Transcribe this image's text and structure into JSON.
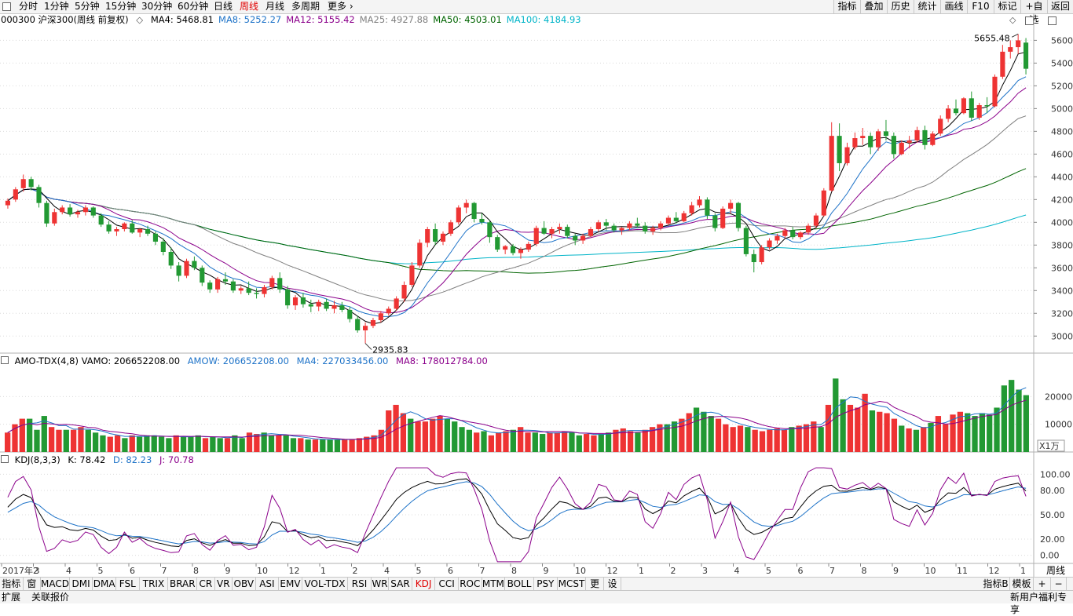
{
  "topbar": {
    "tabs": [
      "分时",
      "1分钟",
      "5分钟",
      "15分钟",
      "30分钟",
      "60分钟",
      "日线",
      "周线",
      "月线",
      "多周期",
      "更多"
    ],
    "active_tab": "周线",
    "right_tabs": [
      "指标",
      "叠加",
      "历史",
      "统计",
      "画线",
      "F10",
      "标记",
      "+自选",
      "返回"
    ]
  },
  "main_panel": {
    "stock_label": "000300 沪深300(周线 前复权)",
    "ma": [
      {
        "label": "MA4: 5468.81",
        "color": "#000000"
      },
      {
        "label": "MA8: 5252.27",
        "color": "#1e73c8"
      },
      {
        "label": "MA12: 5155.42",
        "color": "#8b008b"
      },
      {
        "label": "MA25: 4927.88",
        "color": "#808080"
      },
      {
        "label": "MA50: 4503.01",
        "color": "#006400"
      },
      {
        "label": "MA100: 4184.93",
        "color": "#00b4c8"
      }
    ],
    "y_ticks": [
      "5600",
      "5400",
      "5200",
      "5000",
      "4800",
      "4600",
      "4400",
      "4200",
      "4000",
      "3800",
      "3600",
      "3400",
      "3200",
      "3000"
    ],
    "high_label": "5655.48",
    "low_label": "2935.83"
  },
  "volume_panel": {
    "label": "AMO-TDX(4,8) VAMO: 206652208.00",
    "amow": "AMOW: 206652208.00",
    "ma4": "MA4: 227033456.00",
    "ma8": "MA8: 178012784.00",
    "y_ticks": [
      "20000",
      "10000"
    ],
    "unit": "X1万"
  },
  "kdj_panel": {
    "label": "KDJ(8,3,3)",
    "k": "K: 78.42",
    "d": "D: 82.23",
    "j": "J: 70.78",
    "y_ticks": [
      "100.00",
      "80.00",
      "50.00",
      "20.00",
      "0.00"
    ]
  },
  "x_axis": [
    "2017年2",
    "3",
    "4",
    "5",
    "6",
    "7",
    "8",
    "9",
    "10",
    "12",
    "1",
    "2",
    "4",
    "5",
    "6",
    "7",
    "8",
    "9",
    "10",
    "12",
    "1",
    "2",
    "3",
    "4",
    "5",
    "6",
    "7",
    "8",
    "9",
    "10",
    "11",
    "12",
    "1"
  ],
  "period_label": "周线",
  "indicator_tabs": [
    "指标A",
    "窗口",
    "MACD",
    "DMI",
    "DMA",
    "FSL",
    "TRIX",
    "BRAR",
    "CR",
    "VR",
    "OBV",
    "ASI",
    "EMV",
    "VOL-TDX",
    "RSI",
    "WR",
    "SAR",
    "KDJ",
    "CCI",
    "ROC",
    "MTM",
    "BOLL",
    "PSY",
    "MCST",
    "更多",
    "设置"
  ],
  "active_indicator": "KDJ",
  "right_buttons": [
    "指标B",
    "模板",
    "+",
    "−"
  ],
  "status": {
    "left1": "扩展",
    "left2": "关联报价",
    "right": "新用户福利专享"
  },
  "colors": {
    "up": "#ee3333",
    "down": "#229933",
    "accent": "#e00000"
  },
  "chart_data": [
    {
      "type": "candlestick",
      "title": "000300 沪深300(周线 前复权)",
      "ylim": [
        2850,
        5720
      ],
      "high": 5655.48,
      "low": 2935.83,
      "ohlc": [
        [
          4150,
          4210,
          4120,
          4190
        ],
        [
          4200,
          4310,
          4180,
          4290
        ],
        [
          4300,
          4420,
          4270,
          4380
        ],
        [
          4380,
          4400,
          4280,
          4310
        ],
        [
          4310,
          4330,
          4130,
          4170
        ],
        [
          4170,
          4190,
          3960,
          3990
        ],
        [
          3990,
          4120,
          3970,
          4090
        ],
        [
          4090,
          4150,
          4070,
          4130
        ],
        [
          4130,
          4160,
          4050,
          4070
        ],
        [
          4070,
          4110,
          4040,
          4090
        ],
        [
          4090,
          4150,
          4060,
          4130
        ],
        [
          4130,
          4140,
          4040,
          4060
        ],
        [
          4060,
          4080,
          3960,
          3980
        ],
        [
          3980,
          4010,
          3900,
          3920
        ],
        [
          3920,
          3960,
          3880,
          3940
        ],
        [
          3940,
          4000,
          3920,
          3990
        ],
        [
          3990,
          4020,
          3900,
          3910
        ],
        [
          3910,
          3950,
          3870,
          3940
        ],
        [
          3940,
          3970,
          3880,
          3900
        ],
        [
          3900,
          3920,
          3800,
          3830
        ],
        [
          3830,
          3860,
          3710,
          3740
        ],
        [
          3740,
          3780,
          3590,
          3620
        ],
        [
          3620,
          3650,
          3480,
          3530
        ],
        [
          3530,
          3680,
          3510,
          3660
        ],
        [
          3660,
          3700,
          3580,
          3600
        ],
        [
          3600,
          3620,
          3440,
          3470
        ],
        [
          3470,
          3490,
          3380,
          3410
        ],
        [
          3410,
          3520,
          3380,
          3500
        ],
        [
          3500,
          3560,
          3450,
          3480
        ],
        [
          3480,
          3500,
          3380,
          3400
        ],
        [
          3400,
          3440,
          3370,
          3420
        ],
        [
          3420,
          3480,
          3360,
          3380
        ],
        [
          3380,
          3420,
          3330,
          3370
        ],
        [
          3370,
          3450,
          3340,
          3430
        ],
        [
          3430,
          3530,
          3410,
          3510
        ],
        [
          3510,
          3560,
          3380,
          3410
        ],
        [
          3410,
          3440,
          3240,
          3270
        ],
        [
          3270,
          3360,
          3230,
          3340
        ],
        [
          3340,
          3380,
          3250,
          3280
        ],
        [
          3280,
          3320,
          3210,
          3260
        ],
        [
          3260,
          3320,
          3220,
          3300
        ],
        [
          3300,
          3330,
          3220,
          3240
        ],
        [
          3240,
          3310,
          3200,
          3270
        ],
        [
          3270,
          3300,
          3210,
          3230
        ],
        [
          3230,
          3260,
          3120,
          3150
        ],
        [
          3150,
          3180,
          3030,
          3050
        ],
        [
          3050,
          3120,
          2936,
          3090
        ],
        [
          3090,
          3160,
          3070,
          3140
        ],
        [
          3140,
          3220,
          3120,
          3200
        ],
        [
          3200,
          3260,
          3180,
          3240
        ],
        [
          3240,
          3350,
          3220,
          3330
        ],
        [
          3330,
          3480,
          3300,
          3450
        ],
        [
          3450,
          3650,
          3430,
          3620
        ],
        [
          3620,
          3850,
          3600,
          3820
        ],
        [
          3820,
          3960,
          3780,
          3940
        ],
        [
          3940,
          3990,
          3800,
          3830
        ],
        [
          3830,
          3920,
          3800,
          3900
        ],
        [
          3900,
          4020,
          3880,
          4000
        ],
        [
          4000,
          4150,
          3980,
          4130
        ],
        [
          4130,
          4200,
          4080,
          4170
        ],
        [
          4170,
          4180,
          4000,
          4030
        ],
        [
          4030,
          4080,
          3980,
          4000
        ],
        [
          4000,
          4020,
          3820,
          3870
        ],
        [
          3870,
          3890,
          3740,
          3760
        ],
        [
          3760,
          3800,
          3720,
          3790
        ],
        [
          3790,
          3810,
          3710,
          3730
        ],
        [
          3730,
          3780,
          3680,
          3760
        ],
        [
          3760,
          3830,
          3740,
          3810
        ],
        [
          3810,
          3970,
          3790,
          3950
        ],
        [
          3950,
          4010,
          3890,
          3900
        ],
        [
          3900,
          3960,
          3860,
          3940
        ],
        [
          3940,
          3990,
          3900,
          3960
        ],
        [
          3960,
          3980,
          3860,
          3880
        ],
        [
          3880,
          3900,
          3800,
          3840
        ],
        [
          3840,
          3900,
          3810,
          3880
        ],
        [
          3880,
          3960,
          3870,
          3940
        ],
        [
          3940,
          4020,
          3920,
          4000
        ],
        [
          4000,
          4030,
          3930,
          3970
        ],
        [
          3970,
          3990,
          3910,
          3930
        ],
        [
          3930,
          3960,
          3890,
          3950
        ],
        [
          3950,
          4010,
          3930,
          3990
        ],
        [
          3990,
          4040,
          3950,
          3970
        ],
        [
          3970,
          4000,
          3900,
          3920
        ],
        [
          3920,
          3970,
          3890,
          3950
        ],
        [
          3950,
          4010,
          3930,
          3990
        ],
        [
          3990,
          4060,
          3970,
          4040
        ],
        [
          4040,
          4090,
          3990,
          4010
        ],
        [
          4010,
          4100,
          4000,
          4080
        ],
        [
          4080,
          4180,
          4060,
          4150
        ],
        [
          4150,
          4230,
          4130,
          4200
        ],
        [
          4200,
          4220,
          4030,
          4060
        ],
        [
          4060,
          4080,
          3920,
          3950
        ],
        [
          3950,
          4140,
          3940,
          4120
        ],
        [
          4120,
          4200,
          4080,
          4170
        ],
        [
          4170,
          4180,
          3920,
          3950
        ],
        [
          3950,
          3970,
          3700,
          3720
        ],
        [
          3720,
          3760,
          3560,
          3650
        ],
        [
          3650,
          3800,
          3630,
          3780
        ],
        [
          3780,
          3860,
          3760,
          3840
        ],
        [
          3840,
          3900,
          3810,
          3880
        ],
        [
          3880,
          3950,
          3860,
          3930
        ],
        [
          3930,
          3960,
          3850,
          3870
        ],
        [
          3870,
          3920,
          3850,
          3910
        ],
        [
          3910,
          3990,
          3890,
          3970
        ],
        [
          3970,
          4080,
          3950,
          4060
        ],
        [
          4060,
          4300,
          4050,
          4280
        ],
        [
          4280,
          4880,
          4270,
          4760
        ],
        [
          4760,
          4870,
          4450,
          4520
        ],
        [
          4520,
          4700,
          4500,
          4660
        ],
        [
          4660,
          4790,
          4640,
          4740
        ],
        [
          4740,
          4830,
          4680,
          4760
        ],
        [
          4760,
          4790,
          4600,
          4660
        ],
        [
          4660,
          4820,
          4630,
          4800
        ],
        [
          4800,
          4900,
          4720,
          4760
        ],
        [
          4760,
          4790,
          4560,
          4600
        ],
        [
          4600,
          4720,
          4590,
          4700
        ],
        [
          4700,
          4760,
          4650,
          4720
        ],
        [
          4720,
          4840,
          4700,
          4810
        ],
        [
          4810,
          4850,
          4640,
          4680
        ],
        [
          4680,
          4800,
          4670,
          4780
        ],
        [
          4780,
          4940,
          4760,
          4910
        ],
        [
          4910,
          5030,
          4880,
          5000
        ],
        [
          5000,
          5080,
          4940,
          4960
        ],
        [
          4960,
          5100,
          4950,
          5090
        ],
        [
          5090,
          5150,
          4890,
          4920
        ],
        [
          4920,
          5050,
          4900,
          5030
        ],
        [
          5030,
          5100,
          4960,
          5020
        ],
        [
          5020,
          5300,
          5010,
          5280
        ],
        [
          5280,
          5560,
          5260,
          5500
        ],
        [
          5500,
          5600,
          5440,
          5540
        ],
        [
          5540,
          5655,
          5480,
          5600
        ],
        [
          5580,
          5620,
          5300,
          5350
        ]
      ]
    },
    {
      "type": "bar",
      "title": "AMO-TDX(4,8)",
      "unit": "X1万",
      "ylim": [
        0,
        30000
      ],
      "values": [
        7000,
        10000,
        12000,
        12000,
        8000,
        13000,
        9000,
        8000,
        8000,
        8000,
        9000,
        8000,
        7000,
        6000,
        5500,
        6000,
        5000,
        6000,
        5500,
        6000,
        6000,
        5500,
        5000,
        6000,
        5500,
        5500,
        6000,
        5000,
        5500,
        5000,
        5000,
        6000,
        5000,
        7000,
        6500,
        7000,
        6000,
        6000,
        6000,
        5000,
        5000,
        4500,
        4500,
        4500,
        4500,
        4500,
        4500,
        4500,
        5000,
        5500,
        6000,
        8000,
        15000,
        17000,
        14000,
        12000,
        11000,
        11000,
        12000,
        13000,
        12000,
        11000,
        9000,
        8000,
        7000,
        7500,
        6000,
        7000,
        7500,
        8000,
        9000,
        7000,
        7000,
        6500,
        7000,
        7000,
        7500,
        7000,
        6000,
        6500,
        6000,
        6500,
        7000,
        8000,
        8500,
        7500,
        7000,
        8000,
        9000,
        10000,
        10000,
        11000,
        12000,
        14000,
        16000,
        14500,
        13000,
        12000,
        10000,
        9000,
        9500,
        9000,
        8000,
        7500,
        8000,
        8500,
        8000,
        9000,
        9500,
        10000,
        11000,
        9000,
        17000,
        26500,
        19000,
        17000,
        16000,
        21000,
        15000,
        14500,
        14000,
        12000,
        9500,
        8500,
        8000,
        9000,
        10500,
        13000,
        10000,
        13500,
        14500,
        14000,
        13000,
        14000,
        13500,
        16000,
        24000,
        26000,
        22500,
        20500
      ]
    },
    {
      "type": "line",
      "title": "KDJ(8,3,3)",
      "ylim": [
        -10,
        110
      ],
      "series": [
        {
          "name": "K",
          "values": [
            78.42
          ]
        },
        {
          "name": "D",
          "values": [
            82.23
          ]
        },
        {
          "name": "J",
          "values": [
            70.78
          ]
        }
      ]
    }
  ]
}
